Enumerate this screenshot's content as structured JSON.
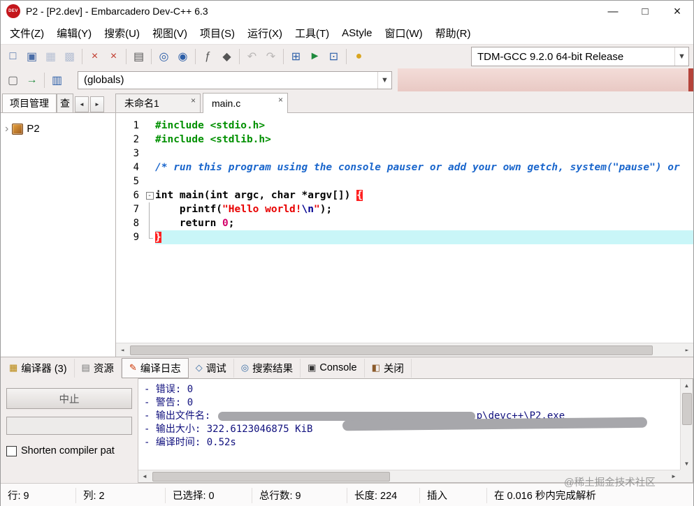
{
  "window": {
    "title": "P2 - [P2.dev] - Embarcadero Dev-C++ 6.3",
    "logo_text": "DEV",
    "minimize": "—",
    "maximize": "□",
    "close": "×"
  },
  "icons": {
    "up": "▲",
    "down": "▼",
    "left": "◄",
    "right": "►",
    "dropdown": "▼",
    "tree_expand": "›"
  },
  "menubar": [
    "文件(Z)",
    "编辑(Y)",
    "搜索(U)",
    "视图(V)",
    "项目(S)",
    "运行(X)",
    "工具(T)",
    "AStyle",
    "窗口(W)",
    "帮助(R)"
  ],
  "toolbar1": {
    "groups": [
      [
        {
          "name": "new-file-icon",
          "g": "□",
          "c": "#4a6da7"
        },
        {
          "name": "open-file-icon",
          "g": "▣",
          "c": "#4a6da7"
        },
        {
          "name": "save-icon",
          "g": "▦",
          "c": "#4a6da7",
          "disabled": true
        },
        {
          "name": "save-all-icon",
          "g": "▩",
          "c": "#4a6da7",
          "disabled": true
        }
      ],
      [
        {
          "name": "close-file-icon",
          "g": "×",
          "c": "#c0392b"
        },
        {
          "name": "close-all-icon",
          "g": "×",
          "c": "#c0392b"
        }
      ],
      [
        {
          "name": "print-icon",
          "g": "▤",
          "c": "#555555"
        }
      ],
      [
        {
          "name": "find-icon",
          "g": "◎",
          "c": "#2d5fa8"
        },
        {
          "name": "replace-icon",
          "g": "◉",
          "c": "#2d5fa8"
        }
      ],
      [
        {
          "name": "goto-function-icon",
          "g": "ƒ",
          "c": "#555555"
        },
        {
          "name": "bookmark-icon",
          "g": "◆",
          "c": "#555555"
        }
      ],
      [
        {
          "name": "undo-icon",
          "g": "↶",
          "c": "#555555",
          "disabled": true
        },
        {
          "name": "redo-icon",
          "g": "↷",
          "c": "#555555",
          "disabled": true
        }
      ],
      [
        {
          "name": "compile-icon",
          "g": "⊞",
          "c": "#2d5fa8"
        },
        {
          "name": "run-icon",
          "g": "►",
          "c": "#1f8a3d"
        },
        {
          "name": "compile-run-icon",
          "g": "⊡",
          "c": "#2d5fa8"
        }
      ],
      [
        {
          "name": "profile-icon",
          "g": "●",
          "c": "#d9a520"
        }
      ]
    ],
    "compiler_select": "TDM-GCC 9.2.0 64-bit Release"
  },
  "toolbar2": {
    "groups": [
      [
        {
          "name": "new-window-icon",
          "g": "▢",
          "c": "#666666"
        },
        {
          "name": "goto-icon",
          "g": "→",
          "c": "#1f8a3d"
        }
      ],
      [
        {
          "name": "class-browser-icon",
          "g": "▥",
          "c": "#2d5fa8"
        }
      ]
    ],
    "globals": "(globals)"
  },
  "project_panel": {
    "tab": "项目管理",
    "tab_partial": "查",
    "root": "P2"
  },
  "editor": {
    "tabs": [
      {
        "label": "未命名1",
        "close": "×",
        "active": false
      },
      {
        "label": "main.c",
        "close": "×",
        "active": true
      }
    ],
    "lines": [
      {
        "num": 1,
        "tokens": [
          {
            "c": "pp",
            "t": "#include <stdio.h>"
          }
        ]
      },
      {
        "num": 2,
        "tokens": [
          {
            "c": "pp",
            "t": "#include <stdlib.h>"
          }
        ]
      },
      {
        "num": 3,
        "tokens": []
      },
      {
        "num": 4,
        "tokens": [
          {
            "c": "cmt",
            "t": "/* run this program using the console pauser or add your own getch, system(\"pause\") or"
          }
        ]
      },
      {
        "num": 5,
        "tokens": []
      },
      {
        "num": 6,
        "fold": "open",
        "tokens": [
          {
            "c": "kw",
            "t": "int"
          },
          {
            "c": "pl",
            "t": " main("
          },
          {
            "c": "kw",
            "t": "int"
          },
          {
            "c": "pl",
            "t": " argc, "
          },
          {
            "c": "kw",
            "t": "char"
          },
          {
            "c": "pl",
            "t": " *argv[]) "
          },
          {
            "c": "brace",
            "t": "{"
          }
        ]
      },
      {
        "num": 7,
        "fold": "line",
        "tokens": [
          {
            "c": "pl",
            "t": "    printf("
          },
          {
            "c": "str",
            "t": "\"Hello world!"
          },
          {
            "c": "esc",
            "t": "\\n"
          },
          {
            "c": "str",
            "t": "\""
          },
          {
            "c": "pl",
            "t": ");"
          }
        ]
      },
      {
        "num": 8,
        "fold": "line",
        "tokens": [
          {
            "c": "pl",
            "t": "    "
          },
          {
            "c": "kw",
            "t": "return"
          },
          {
            "c": "pl",
            "t": " "
          },
          {
            "c": "num",
            "t": "0"
          },
          {
            "c": "pl",
            "t": ";"
          }
        ]
      },
      {
        "num": 9,
        "fold": "end",
        "highlight": true,
        "tokens": [
          {
            "c": "brace",
            "t": "}"
          }
        ]
      }
    ]
  },
  "bottom_tabs": [
    {
      "name": "tab-compiler",
      "icon": "compiler-icon",
      "g": "▦",
      "c": "#b8860b",
      "label": "编译器 (3)"
    },
    {
      "name": "tab-resources",
      "icon": "resources-icon",
      "g": "▤",
      "c": "#777777",
      "label": "资源"
    },
    {
      "name": "tab-compile-log",
      "icon": "compile-log-icon",
      "g": "✎",
      "c": "#cc3300",
      "label": "编译日志",
      "active": true
    },
    {
      "name": "tab-debug",
      "icon": "debug-icon",
      "g": "◇",
      "c": "#3a6ea5",
      "label": "调试"
    },
    {
      "name": "tab-search-results",
      "icon": "search-results-icon",
      "g": "◎",
      "c": "#3a6ea5",
      "label": "搜索结果"
    },
    {
      "name": "tab-console",
      "icon": "console-icon",
      "g": "▣",
      "c": "#333333",
      "label": "Console"
    },
    {
      "name": "tab-close-panel",
      "icon": "close-panel-icon",
      "g": "◧",
      "c": "#8b5a2b",
      "label": "关闭"
    }
  ],
  "bottom_left": {
    "abort": "中止",
    "shorten_label": "Shorten compiler pat"
  },
  "log": {
    "lines": [
      {
        "text": "- 错误: 0"
      },
      {
        "text": "- 警告: 0"
      },
      {
        "prefix": "- 输出文件名: ",
        "censored": true,
        "suffix": "p\\devc++\\P2.exe"
      },
      {
        "text": "- 输出大小: 322.6123046875 KiB"
      },
      {
        "text": "- 编译时间: 0.52s"
      }
    ]
  },
  "statusbar": {
    "items": [
      "行:  9",
      "列:  2",
      "已选择: 0",
      "总行数: 9",
      "长度: 224",
      "插入",
      "在 0.016 秒内完成解析"
    ]
  },
  "watermark": "@稀土掘金技术社区"
}
